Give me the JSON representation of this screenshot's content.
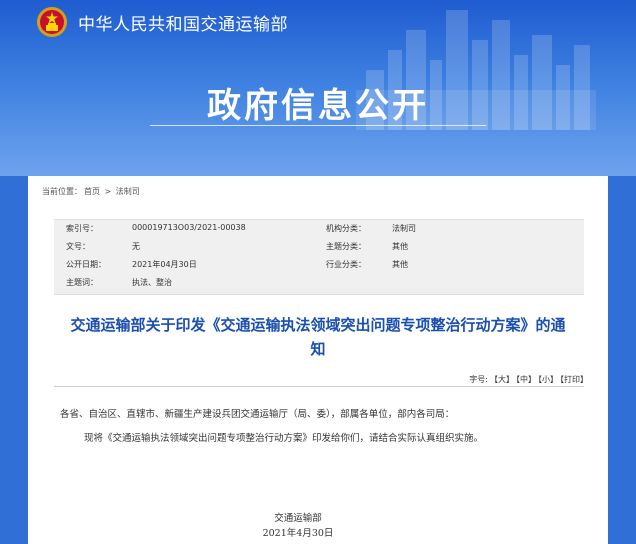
{
  "header": {
    "ministry_name": "中华人民共和国交通运输部",
    "banner_title": "政府信息公开"
  },
  "breadcrumb": {
    "label": "当前位置：",
    "home": "首页",
    "separator": ">",
    "section": "法制司"
  },
  "meta": {
    "index_no_label": "索引号：",
    "index_no": "000019713O03/2021-00038",
    "org_label": "机构分类：",
    "org": "法制司",
    "doc_no_label": "文号：",
    "doc_no": "无",
    "topic_label": "主题分类：",
    "topic": "其他",
    "date_label": "公开日期：",
    "date": "2021年04月30日",
    "industry_label": "行业分类：",
    "industry": "其他",
    "keywords_label": "主题词：",
    "keywords": "执法、整治"
  },
  "document": {
    "title_line1": "交通运输部关于印发《交通运输执法领域突出问题专项整治行动方案》的通",
    "title_line2": "知",
    "salutation": "各省、自治区、直辖市、新疆生产建设兵团交通运输厅（局、委），部属各单位，部内各司局：",
    "body": "现将《交通运输执法领域突出问题专项整治行动方案》印发给你们，请结合实际认真组织实施。",
    "signature_org": "交通运输部",
    "signature_date": "2021年4月30日"
  },
  "font_size": {
    "label": "字号:",
    "large": "【大】",
    "medium": "【中】",
    "small": "【小】",
    "print": "【打印】"
  },
  "colors": {
    "header_blue": "#1f5cd0",
    "title_blue": "#1a4fb0",
    "meta_bg": "#f0f0f0"
  }
}
